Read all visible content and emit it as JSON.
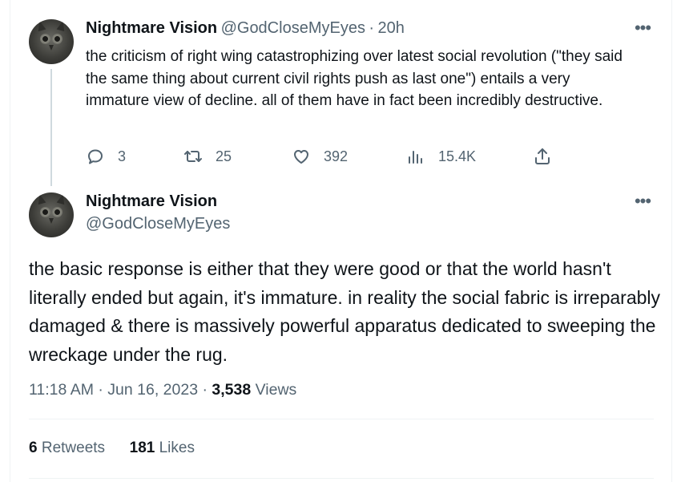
{
  "tweet1": {
    "name": "Nightmare Vision",
    "handle": "@GodCloseMyEyes",
    "separator": "·",
    "time": "20h",
    "more": "•••",
    "text": "the criticism of right wing catastrophizing over latest social revolution (\"they said the same thing about current civil rights push as last one\") entails a very immature view of decline. all of them have in fact been incredibly destructive.",
    "replies": "3",
    "retweets": "25",
    "likes": "392",
    "views": "15.4K"
  },
  "tweet2": {
    "name": "Nightmare Vision",
    "handle": "@GodCloseMyEyes",
    "more": "•••",
    "text": "the basic response is either that they were good or that the world hasn't literally ended but again, it's immature. in reality the social fabric is irreparably damaged & there is massively powerful apparatus dedicated to sweeping the wreckage under the rug.",
    "time": "11:18 AM",
    "date": "Jun 16, 2023",
    "separator": "·",
    "views_count": "3,538",
    "views_label": "Views",
    "retweets_count": "6",
    "retweets_label": "Retweets",
    "likes_count": "181",
    "likes_label": "Likes"
  },
  "icons": {
    "reply": "reply-icon",
    "retweet": "retweet-icon",
    "like": "heart-icon",
    "views": "analytics-icon",
    "share": "share-icon",
    "more": "more-icon"
  },
  "colors": {
    "text": "#0f1419",
    "secondary": "#536471",
    "divider": "#eff3f4",
    "thread_line": "#cfd9de"
  }
}
